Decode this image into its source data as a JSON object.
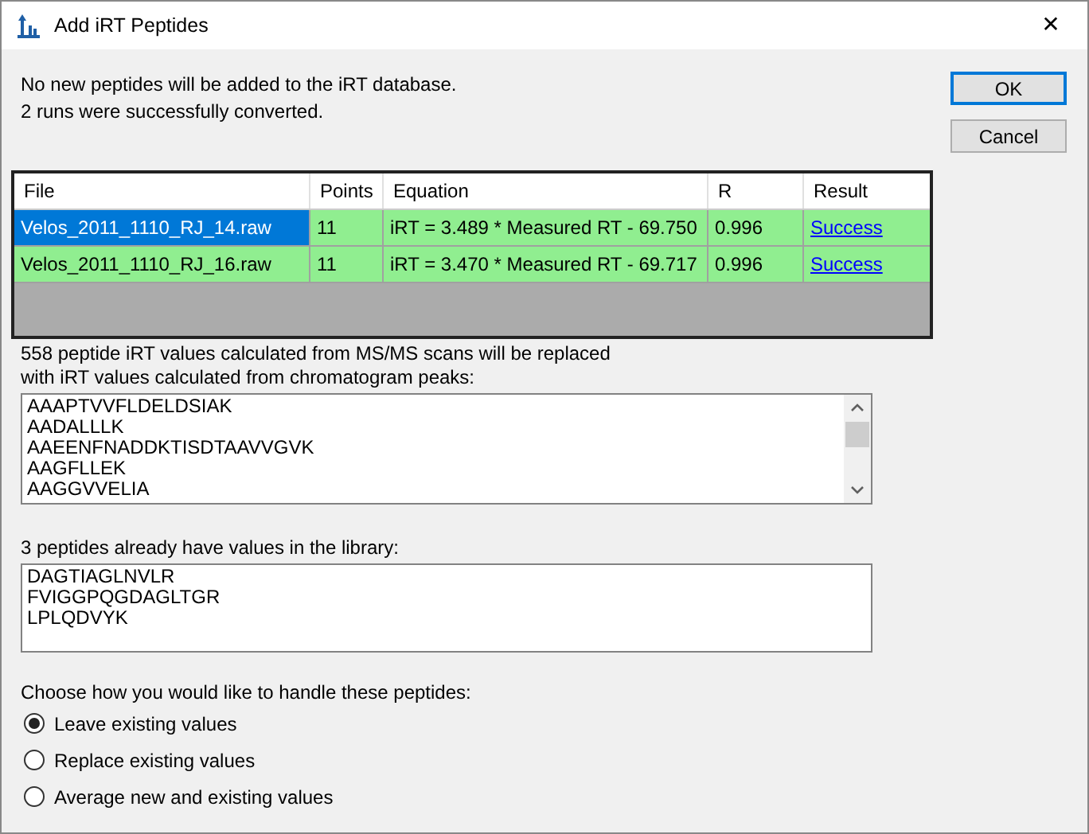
{
  "window": {
    "title": "Add iRT Peptides",
    "close": "✕"
  },
  "messages": [
    "No new peptides will be added to the iRT database.",
    "2 runs were successfully converted."
  ],
  "buttons": [
    "OK",
    "Cancel"
  ],
  "table": {
    "columns": [
      "File",
      "Points",
      "Equation",
      "R",
      "Result"
    ],
    "rows": [
      {
        "selected": true,
        "cells": [
          "Velos_2011_1110_RJ_14.raw",
          "11",
          "iRT = 3.489 * Measured RT - 69.750",
          "0.996",
          "Success"
        ]
      },
      {
        "selected": false,
        "cells": [
          "Velos_2011_1110_RJ_16.raw",
          "11",
          "iRT = 3.470 * Measured RT - 69.717",
          "0.996",
          "Success"
        ]
      }
    ]
  },
  "replaced": {
    "label": "558 peptide iRT values calculated from MS/MS scans will be replaced\nwith iRT values calculated from chromatogram peaks:",
    "items": [
      "AAAPTVVFLDELDSIAK",
      "AADALLLK",
      "AAEENFNADDKTISDTAAVVGVK",
      "AAGFLLEK",
      "AAGGVVELIA"
    ]
  },
  "existing": {
    "label": "3 peptides already have values in the library:",
    "items": [
      "DAGTIAGLNVLR",
      "FVIGGPQGDAGLTGR",
      "LPLQDVYK"
    ]
  },
  "choice": {
    "label": "Choose how you would like to handle these peptides:",
    "options": [
      {
        "label": "Leave existing values",
        "selected": true
      },
      {
        "label": "Replace existing values",
        "selected": false
      },
      {
        "label": "Average new and existing values",
        "selected": false
      }
    ]
  }
}
